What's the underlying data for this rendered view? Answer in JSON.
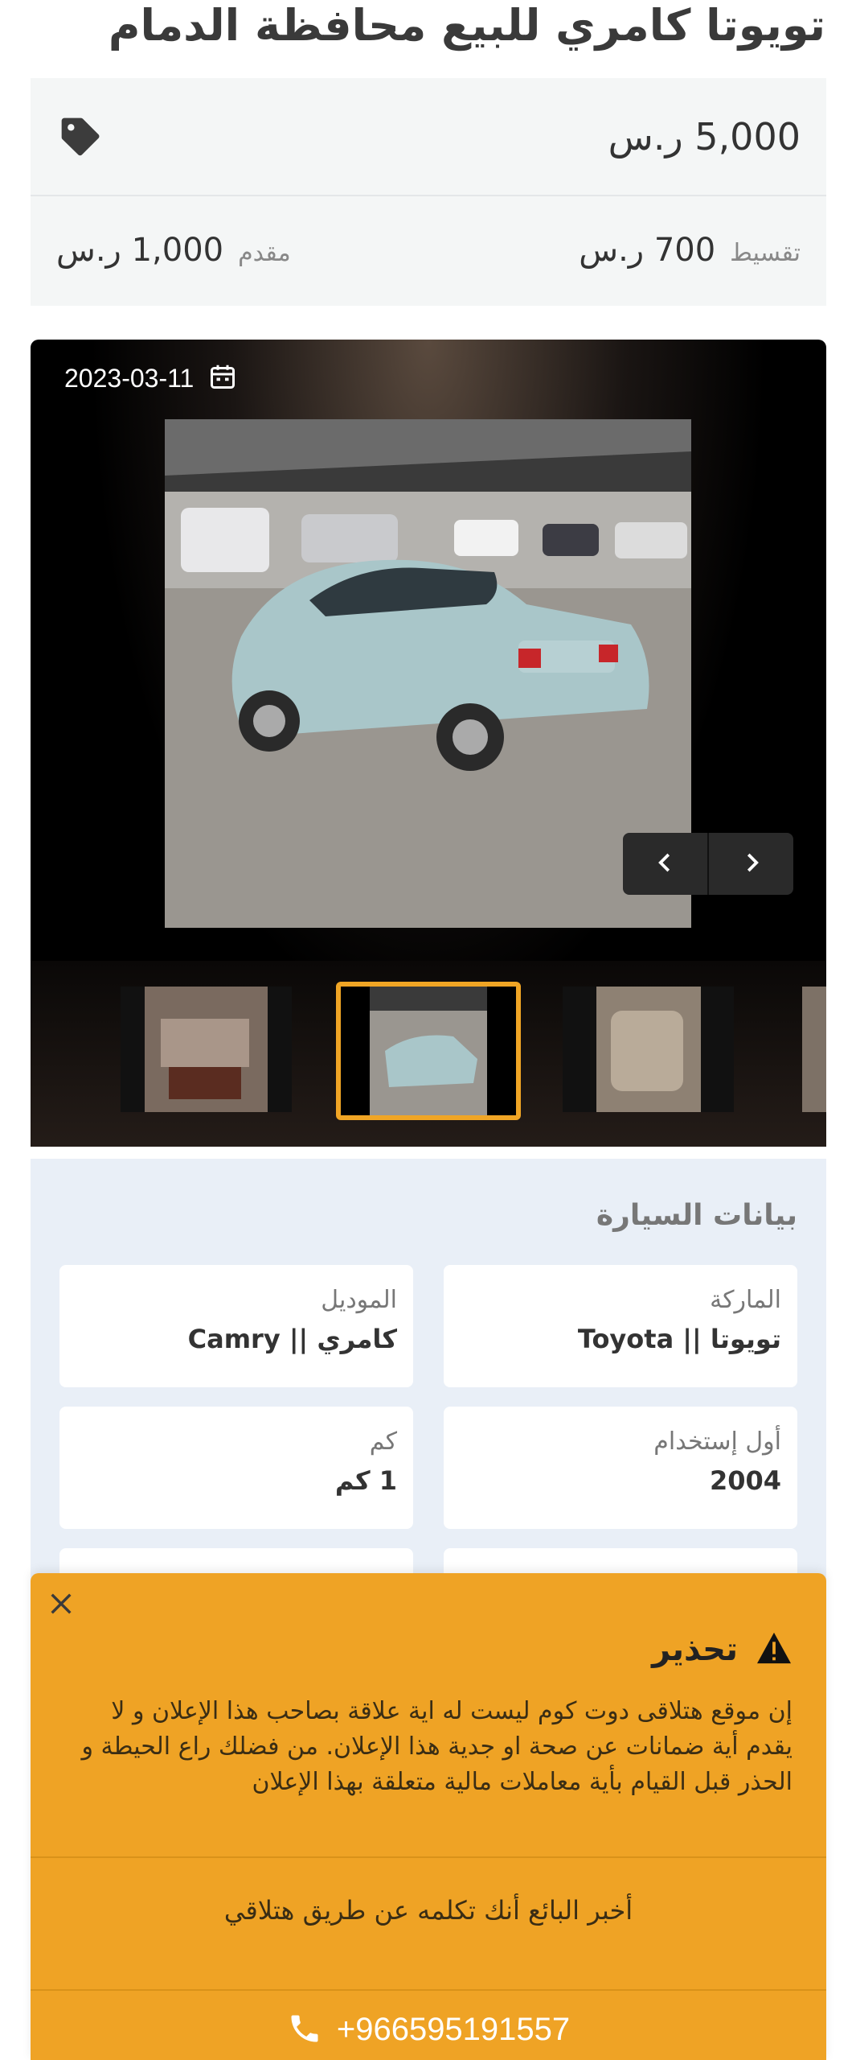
{
  "listing": {
    "title": "تويوتا كامري للبيع محافظة الدمام",
    "price": "5,000 ر.س",
    "installment_label": "تقسيط",
    "installment_value": "700 ر.س",
    "down_payment_label": "مقدم",
    "down_payment_value": "1,000 ر.س"
  },
  "gallery": {
    "date": "2023-03-11",
    "icons": {
      "date": "calendar-icon",
      "prev": "chevron-left-icon",
      "next": "chevron-right-icon"
    }
  },
  "specs": {
    "title": "بيانات السيارة",
    "items": [
      {
        "label": "الماركة",
        "value": "تويوتا || Toyota"
      },
      {
        "label": "الموديل",
        "value": "كامري || Camry"
      },
      {
        "label": "أول إستخدام",
        "value": "2004"
      },
      {
        "label": "كم",
        "value": "1 كم"
      }
    ]
  },
  "warning": {
    "title": "تحذير",
    "body": "إن موقع هتلاقى دوت كوم ليست له اية علاقة بصاحب هذا الإعلان و لا يقدم أية ضمانات عن صحة او جدية هذا الإعلان. من فضلك راع الحيطة و الحذر قبل القيام بأية معاملات مالية متعلقة بهذا الإعلان",
    "tell_seller": "أخبر البائع أنك تكلمه عن طريق هتلاقي",
    "phone": "+966595191557"
  },
  "colors": {
    "accent": "#efa325",
    "specs_bg": "#e9eff7",
    "price_bg": "#f4f6f6"
  }
}
